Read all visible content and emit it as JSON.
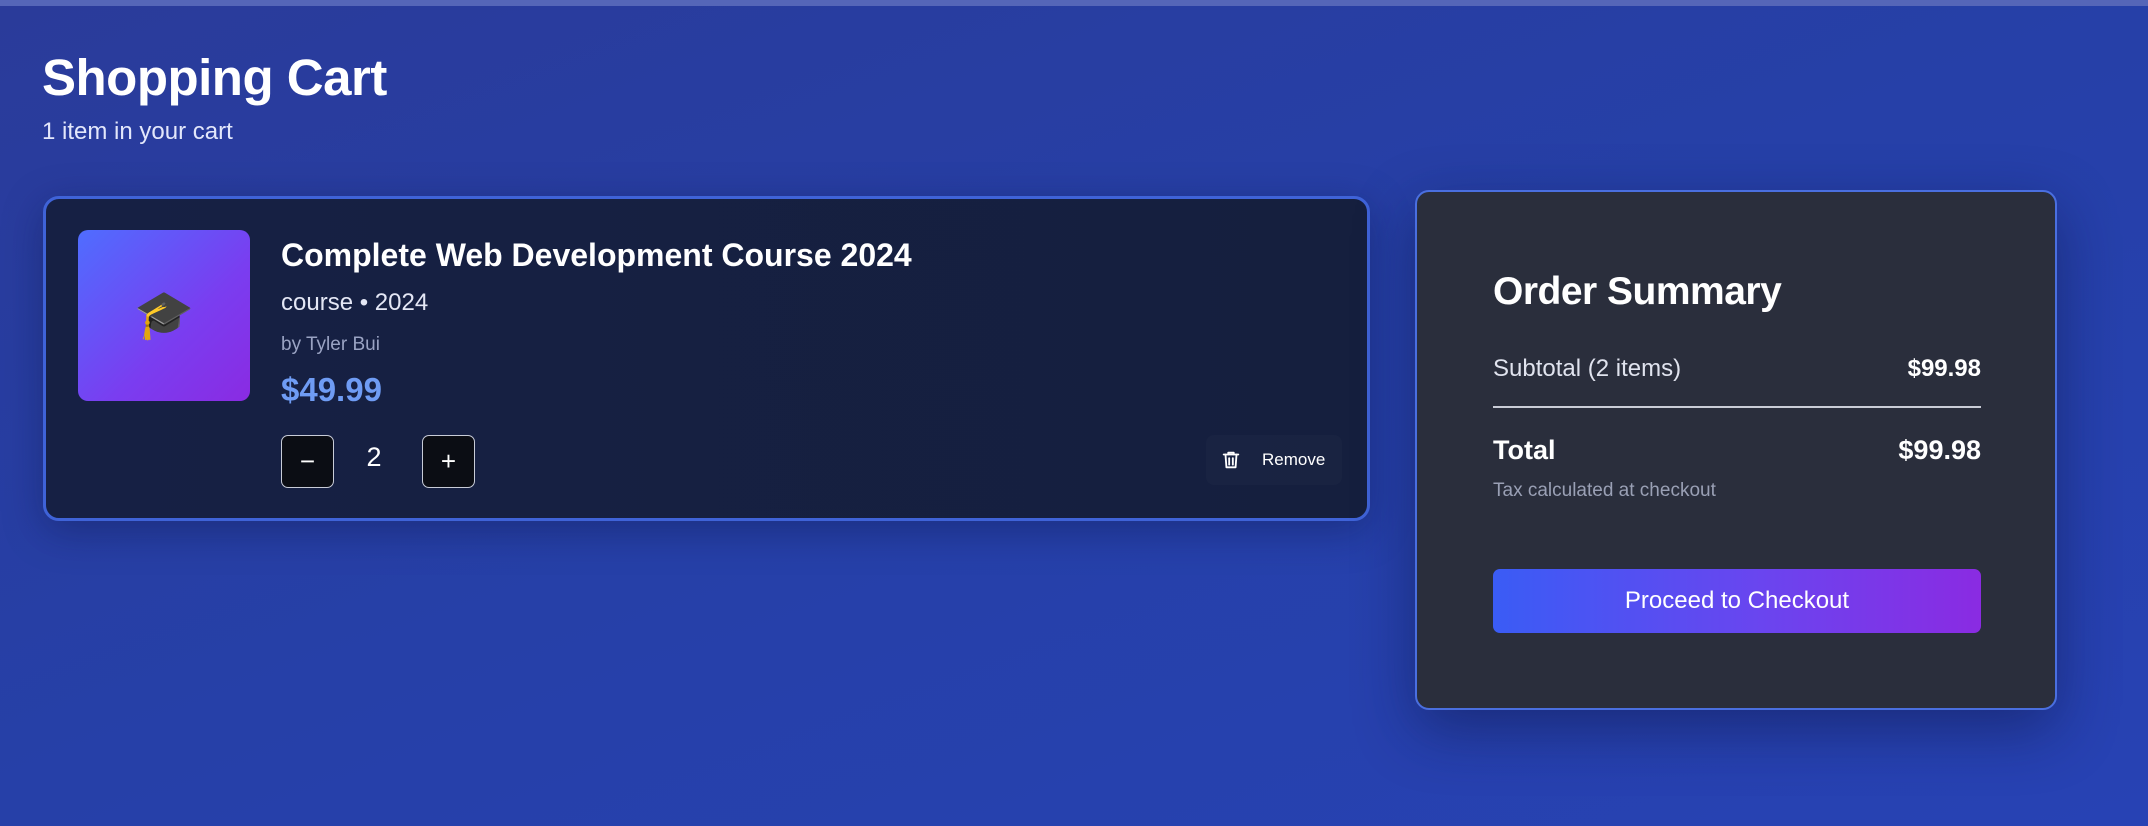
{
  "page": {
    "title": "Shopping Cart",
    "subtitle": "1 item in your cart"
  },
  "cart_items": [
    {
      "thumbnail_icon": "graduation-cap-icon",
      "thumbnail_glyph": "🎓",
      "title": "Complete Web Development Course 2024",
      "meta": "course • 2024",
      "author": "by Tyler Bui",
      "price": "$49.99",
      "quantity": "2",
      "decrement_icon": "minus-icon",
      "decrement_glyph": "−",
      "increment_icon": "plus-icon",
      "increment_glyph": "+",
      "remove_icon": "trash-icon",
      "remove_label": "Remove"
    }
  ],
  "summary": {
    "title": "Order Summary",
    "subtotal_label": "Subtotal (2 items)",
    "subtotal_value": "$99.98",
    "total_label": "Total",
    "total_value": "$99.98",
    "tax_note": "Tax calculated at checkout",
    "checkout_label": "Proceed to Checkout"
  },
  "colors": {
    "background": "#2640a8",
    "card_background": "#151f3e",
    "card_border": "#3f63d8",
    "price_accent": "#6f9cf4",
    "summary_background": "#2a2e3c",
    "checkout_gradient_start": "#3a5cf5",
    "checkout_gradient_end": "#8a2be2"
  }
}
